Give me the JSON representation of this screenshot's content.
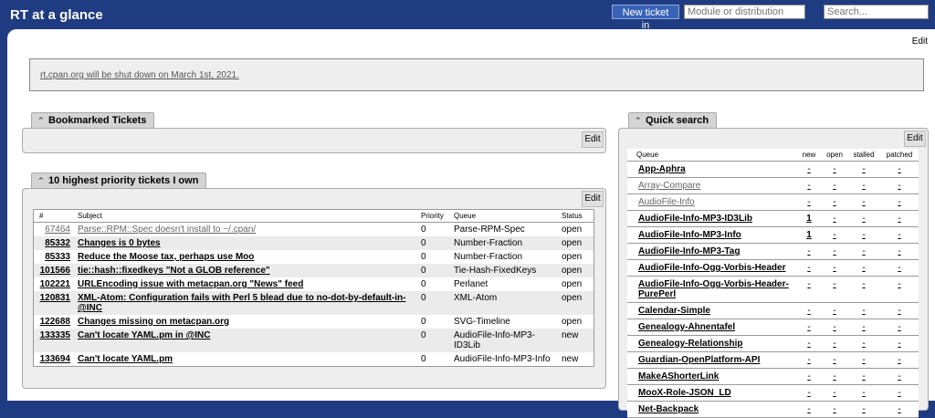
{
  "header": {
    "title": "RT at a glance",
    "new_ticket_label": "New ticket in",
    "queue_placeholder": "Module or distribution",
    "search_placeholder": "Search..."
  },
  "page_edit_label": "Edit",
  "notice": "rt.cpan.org will be shut down on March 1st, 2021.",
  "bookmarked": {
    "title": "Bookmarked Tickets",
    "edit_label": "Edit"
  },
  "priority": {
    "title": "10 highest priority tickets I own",
    "edit_label": "Edit",
    "columns": [
      "#",
      "Subject",
      "Priority",
      "Queue",
      "Status"
    ],
    "rows": [
      {
        "id": "67464",
        "subject": "Parse::RPM::Spec doesn't install to ~/.cpan/",
        "priority": "0",
        "queue": "Parse-RPM-Spec",
        "status": "open"
      },
      {
        "id": "85332",
        "subject": "Changes is 0 bytes",
        "priority": "0",
        "queue": "Number-Fraction",
        "status": "open"
      },
      {
        "id": "85333",
        "subject": "Reduce the Moose tax, perhaps use Moo",
        "priority": "0",
        "queue": "Number-Fraction",
        "status": "open"
      },
      {
        "id": "101566",
        "subject": "tie::hash::fixedkeys \"Not a GLOB reference\"",
        "priority": "0",
        "queue": "Tie-Hash-FixedKeys",
        "status": "open"
      },
      {
        "id": "102221",
        "subject": "URLEncoding issue with metacpan.org \"News\" feed",
        "priority": "0",
        "queue": "Perlanet",
        "status": "open"
      },
      {
        "id": "120831",
        "subject": "XML-Atom: Configuration fails with Perl 5 blead due to no-dot-by-default-in-@INC",
        "priority": "0",
        "queue": "XML-Atom",
        "status": "open"
      },
      {
        "id": "122688",
        "subject": "Changes missing on metacpan.org",
        "priority": "0",
        "queue": "SVG-Timeline",
        "status": "open"
      },
      {
        "id": "133335",
        "subject": "Can't locate YAML.pm in @INC",
        "priority": "0",
        "queue": "AudioFile-Info-MP3-ID3Lib",
        "status": "new"
      },
      {
        "id": "133694",
        "subject": "Can't locate YAML.pm",
        "priority": "0",
        "queue": "AudioFile-Info-MP3-Info",
        "status": "new"
      }
    ]
  },
  "quick_search": {
    "title": "Quick search",
    "edit_label": "Edit",
    "columns": [
      "Queue",
      "new",
      "open",
      "stalled",
      "patched"
    ],
    "rows": [
      {
        "queue": "App-Aphra",
        "new": "-",
        "open": "-",
        "stalled": "-",
        "patched": "-"
      },
      {
        "queue": "Array-Compare",
        "new": "-",
        "open": "-",
        "stalled": "-",
        "patched": "-"
      },
      {
        "queue": "AudioFile-Info",
        "new": "-",
        "open": "-",
        "stalled": "-",
        "patched": "-"
      },
      {
        "queue": "AudioFile-Info-MP3-ID3Lib",
        "new": "1",
        "open": "-",
        "stalled": "-",
        "patched": "-"
      },
      {
        "queue": "AudioFile-Info-MP3-Info",
        "new": "1",
        "open": "-",
        "stalled": "-",
        "patched": "-"
      },
      {
        "queue": "AudioFile-Info-MP3-Tag",
        "new": "-",
        "open": "-",
        "stalled": "-",
        "patched": "-"
      },
      {
        "queue": "AudioFile-Info-Ogg-Vorbis-Header",
        "new": "-",
        "open": "-",
        "stalled": "-",
        "patched": "-"
      },
      {
        "queue": "AudioFile-Info-Ogg-Vorbis-Header-PurePerl",
        "new": "-",
        "open": "-",
        "stalled": "-",
        "patched": "-"
      },
      {
        "queue": "Calendar-Simple",
        "new": "-",
        "open": "-",
        "stalled": "-",
        "patched": "-"
      },
      {
        "queue": "Genealogy-Ahnentafel",
        "new": "-",
        "open": "-",
        "stalled": "-",
        "patched": "-"
      },
      {
        "queue": "Genealogy-Relationship",
        "new": "-",
        "open": "-",
        "stalled": "-",
        "patched": "-"
      },
      {
        "queue": "Guardian-OpenPlatform-API",
        "new": "-",
        "open": "-",
        "stalled": "-",
        "patched": "-"
      },
      {
        "queue": "MakeAShorterLink",
        "new": "-",
        "open": "-",
        "stalled": "-",
        "patched": "-"
      },
      {
        "queue": "MooX-Role-JSON_LD",
        "new": "-",
        "open": "-",
        "stalled": "-",
        "patched": "-"
      },
      {
        "queue": "Net-Backpack",
        "new": "-",
        "open": "-",
        "stalled": "-",
        "patched": "-"
      }
    ]
  }
}
